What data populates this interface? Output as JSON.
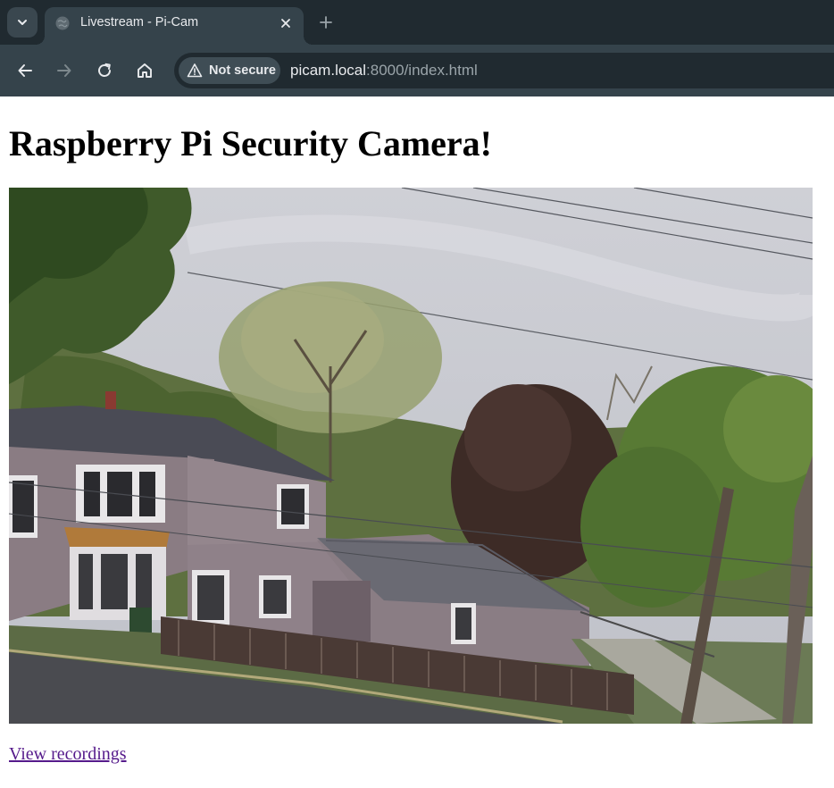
{
  "browser": {
    "tab": {
      "title": "Livestream - Pi-Cam",
      "favicon": "globe-icon"
    },
    "icons": {
      "tab_search": "chevron-down-icon",
      "tab_close": "close-icon",
      "new_tab": "plus-icon",
      "back": "arrow-left-icon",
      "forward": "arrow-right-icon",
      "reload": "reload-icon",
      "home": "home-icon",
      "security": "warning-triangle-icon"
    },
    "security_label": "Not secure",
    "url": {
      "host": "picam.local",
      "rest": ":8000/index.html"
    }
  },
  "page": {
    "title": "Raspberry Pi Security Camera!",
    "stream_alt": "Live camera stream",
    "link_label": "View recordings"
  },
  "colors": {
    "tabstrip": "#202a30",
    "toolbar": "#35434b",
    "link_visited": "#551a8b"
  }
}
